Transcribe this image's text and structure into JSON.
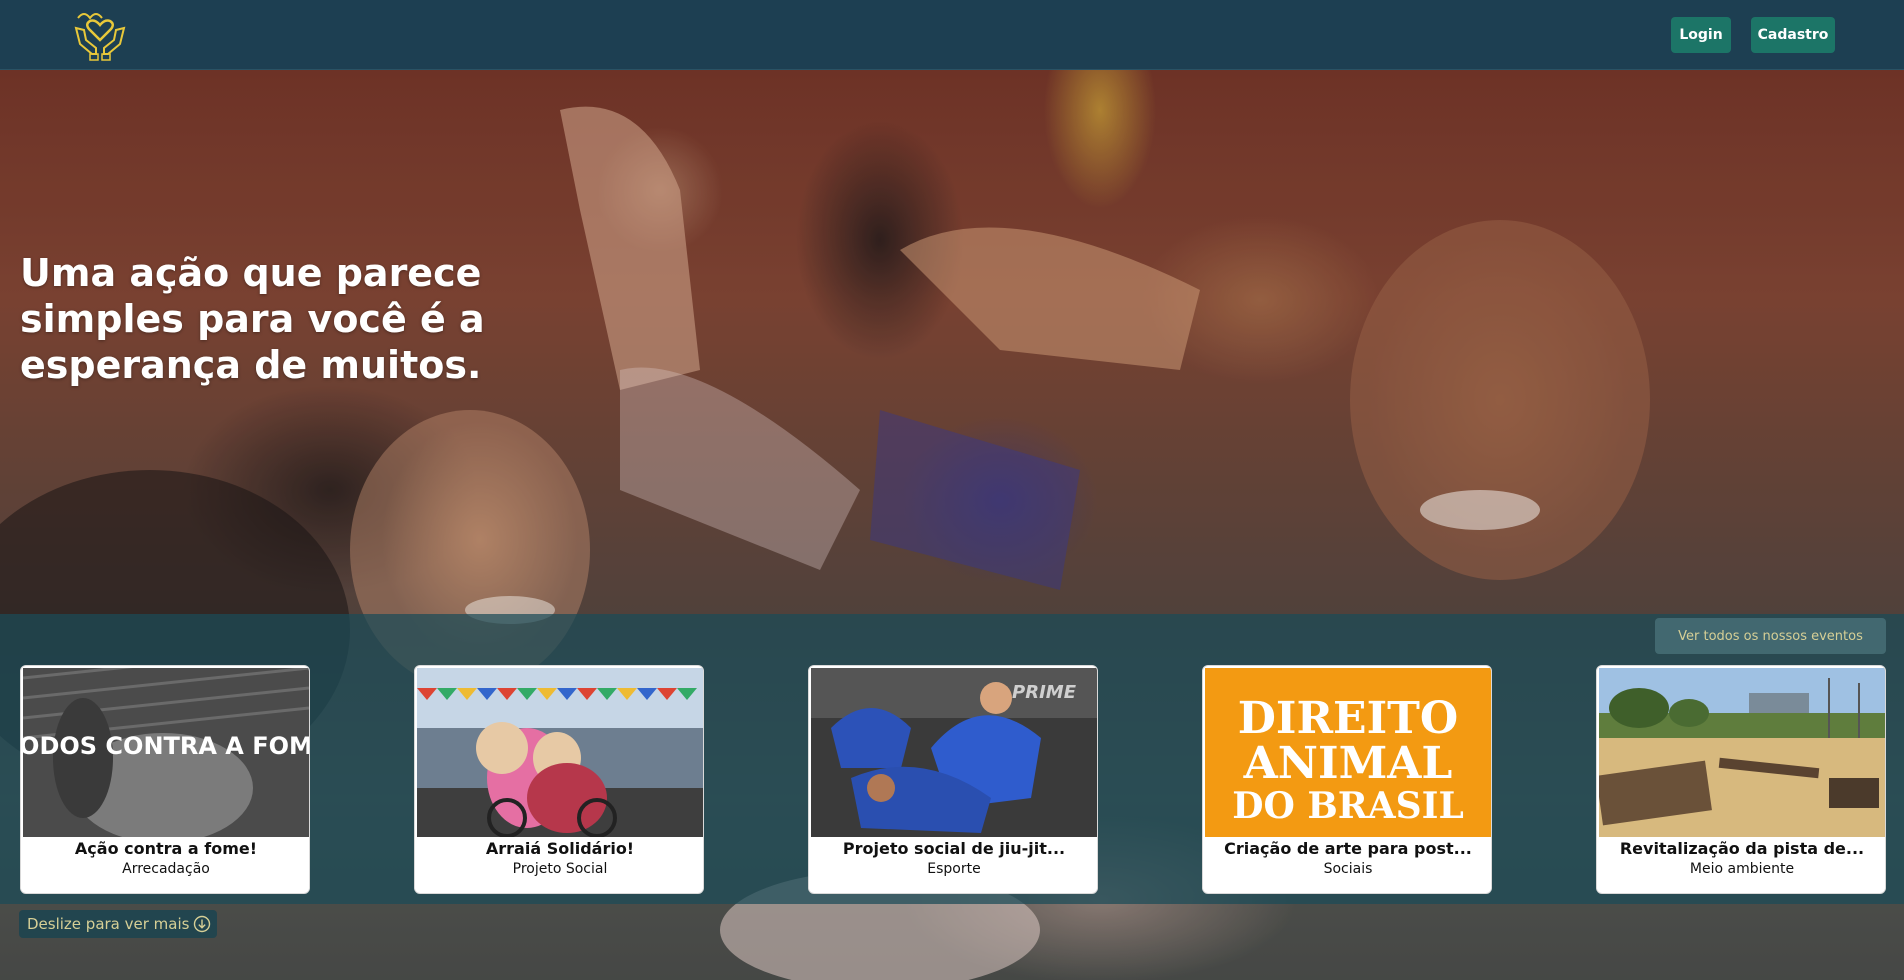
{
  "header": {
    "logo_name": "just-hands-logo",
    "login_label": "Login",
    "signup_label": "Cadastro"
  },
  "hero": {
    "title": "Uma ação que parece simples para você é a esperança de muitos."
  },
  "events": {
    "see_all_label": "Ver todos os nossos eventos",
    "cards": [
      {
        "title": "Ação contra a fome!",
        "category": "Arrecadação",
        "image_text": "TODOS CONTRA A FOME"
      },
      {
        "title": "Arraiá Solidário!",
        "category": "Projeto Social"
      },
      {
        "title": "Projeto social de jiu-jit...",
        "category": "Esporte",
        "image_text": "PRIME"
      },
      {
        "title": "Criação de arte para post...",
        "category": "Sociais",
        "image_text": [
          "DIREITO",
          "ANIMAL",
          "DO BRASIL"
        ]
      },
      {
        "title": "Revitalização da pista de...",
        "category": "Meio ambiente"
      }
    ]
  },
  "scroll_hint": {
    "label": "Deslize para ver mais",
    "icon": "arrow-down-circle-icon"
  },
  "colors": {
    "navbar": "#1d3f52",
    "button": "#1c7567",
    "accent_text": "#d6cf96",
    "logo": "#e8c83a"
  }
}
